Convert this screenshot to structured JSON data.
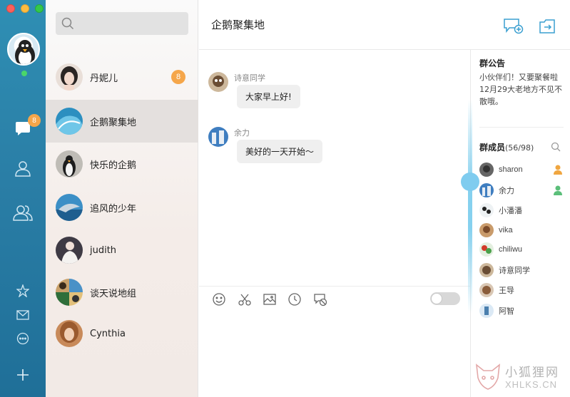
{
  "rail": {
    "badge": "8",
    "colors": {
      "bg": "#2a7ea6",
      "badge": "#f5a64a",
      "online": "#4ad66a"
    },
    "icons": [
      "chat-bubble-icon",
      "contact-icon",
      "group-icon",
      "star-icon",
      "mail-icon",
      "more-icon",
      "plus-icon"
    ]
  },
  "search": {
    "placeholder": ""
  },
  "conversations": [
    {
      "name": "丹妮儿",
      "badge": "8"
    },
    {
      "name": "企鹅聚集地",
      "active": true
    },
    {
      "name": "快乐的企鹅"
    },
    {
      "name": "追风的少年"
    },
    {
      "name": "judith"
    },
    {
      "name": "谈天说地组"
    },
    {
      "name": "Cynthia"
    }
  ],
  "chat": {
    "title": "企鹅聚集地",
    "messages": [
      {
        "sender": "诗意同学",
        "text": "大家早上好!"
      },
      {
        "sender": "余力",
        "text": "美好的一天开始～"
      }
    ],
    "toolbar_icons": [
      "emoji-icon",
      "scissors-icon",
      "image-icon",
      "clock-icon",
      "history-icon"
    ],
    "header_icons": [
      "new-chat-icon",
      "exit-icon"
    ]
  },
  "panel": {
    "announcement_title": "群公告",
    "announcement_text": "小伙伴们！又要聚餐啦12月29大老地方不见不散哦。",
    "members_title": "群成员",
    "members_count": "(56/98)",
    "members": [
      {
        "name": "sharon",
        "role": "owner"
      },
      {
        "name": "余力",
        "role": "admin"
      },
      {
        "name": "小潘潘"
      },
      {
        "name": "vika"
      },
      {
        "name": "chiliwu"
      },
      {
        "name": "诗意同学"
      },
      {
        "name": "王导"
      },
      {
        "name": "阿智"
      }
    ]
  },
  "watermark": {
    "text": "小狐狸网",
    "sub": "XHLKS.CN"
  }
}
